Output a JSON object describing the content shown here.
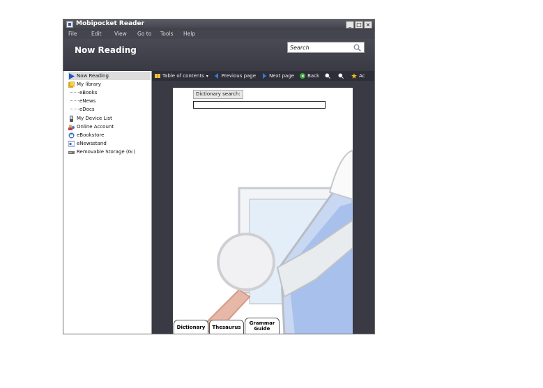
{
  "window": {
    "title": "Mobipocket Reader",
    "controls": [
      "_",
      "□",
      "×"
    ]
  },
  "menu": [
    "File",
    "Edit",
    "View",
    "Go to",
    "Tools",
    "Help"
  ],
  "header": {
    "title": "Now Reading",
    "search_placeholder": "Search"
  },
  "sidebar": {
    "items": [
      {
        "label": "Now Reading",
        "icon": "play-icon",
        "selected": true
      },
      {
        "label": "My library",
        "icon": "library-icon"
      },
      {
        "label": "eBooks",
        "icon": ""
      },
      {
        "label": "eNews",
        "icon": ""
      },
      {
        "label": "eDocs",
        "icon": ""
      },
      {
        "label": "My Device List",
        "icon": "device-icon"
      },
      {
        "label": "Online Account",
        "icon": "account-icon"
      },
      {
        "label": "eBookstore",
        "icon": "store-icon"
      },
      {
        "label": "eNewsstand",
        "icon": "newsstand-icon"
      },
      {
        "label": "Removable Storage (G:)",
        "icon": "drive-icon"
      }
    ]
  },
  "toolbar": {
    "toc": "Table of contents",
    "previous": "Previous page",
    "next": "Next page",
    "back": "Back",
    "more": "Ac"
  },
  "page": {
    "dict_label": "Dictionary search:",
    "dict_value": "",
    "tabs": [
      "Dictionary",
      "Thesaurus",
      "Grammar Guide"
    ]
  },
  "colors": {
    "window_bg": "#3d3d47",
    "toolbar_bg": "#2e2e38",
    "accent_blue": "#3366cc"
  }
}
